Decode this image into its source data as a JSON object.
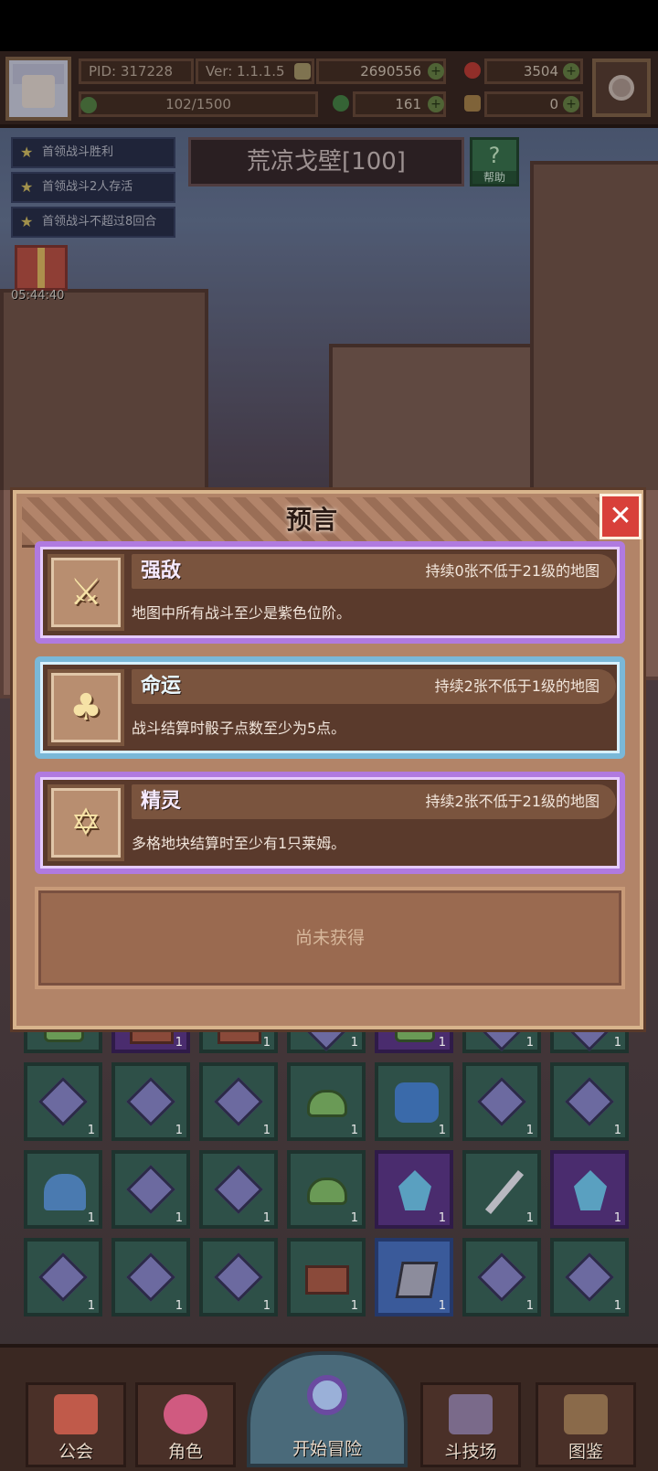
{
  "hud": {
    "pid": "PID: 317228",
    "version": "Ver: 1.1.1.5",
    "gold": "2690556",
    "gems": "3504",
    "exp": "102/1500",
    "clover": "161",
    "keys": "0"
  },
  "quests": [
    {
      "label": "首领战斗胜利"
    },
    {
      "label": "首领战斗2人存活"
    },
    {
      "label": "首领战斗不超过8回合"
    }
  ],
  "gift_timer": "05:44:40",
  "map_title": "荒凉戈壁[100]",
  "help_label": "帮助",
  "help_icon": "question-icon",
  "modal": {
    "title": "预言",
    "close_icon": "close-icon",
    "cards": [
      {
        "name": "强敌",
        "condition": "持续0张不低于21级的地图",
        "description": "地图中所有战斗至少是紫色位阶。",
        "icon": "crossed-swords-icon",
        "color": "purple"
      },
      {
        "name": "命运",
        "condition": "持续2张不低于1级的地图",
        "description": "战斗结算时骰子点数至少为5点。",
        "icon": "clover-icon",
        "color": "cyan"
      },
      {
        "name": "精灵",
        "condition": "持续2张不低于21级的地图",
        "description": "多格地块结算时至少有1只莱姆。",
        "icon": "hexagram-icon",
        "color": "purple"
      }
    ],
    "empty_slot": "尚未获得"
  },
  "grid_counts": [
    "1",
    "1",
    "1",
    "1",
    "1",
    "1",
    "1",
    "1",
    "1",
    "1",
    "1",
    "1",
    "1",
    "1",
    "1",
    "1",
    "1",
    "1",
    "1",
    "1",
    "1",
    "1",
    "1",
    "1"
  ],
  "nav": {
    "guild": "公会",
    "character": "角色",
    "start": "开始冒险",
    "arena": "斗技场",
    "codex": "图鉴"
  },
  "colors": {
    "purple_border": "#b07ae0",
    "cyan_border": "#7ab8d8",
    "close_red": "#d8403a"
  }
}
